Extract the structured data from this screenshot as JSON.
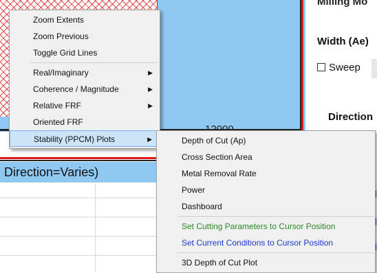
{
  "plot": {
    "axis_value": "12000",
    "direction_label": "Direction=Varies)"
  },
  "right_panel": {
    "cut_text": "Milling Mo",
    "width_label": "Width (Ae)",
    "sweep_label": "Sweep",
    "direction_heading": "Direction"
  },
  "context_menu": {
    "items": [
      {
        "label": "Zoom Extents"
      },
      {
        "label": "Zoom Previous"
      },
      {
        "label": "Toggle Grid Lines"
      },
      {
        "label": "Real/Imaginary",
        "submenu": true
      },
      {
        "label": "Coherence / Magnitude",
        "submenu": true
      },
      {
        "label": "Relative FRF",
        "submenu": true
      },
      {
        "label": "Oriented FRF"
      },
      {
        "label": "Stability (PPCM) Plots",
        "submenu": true,
        "highlighted": true
      }
    ],
    "arrow_glyph": "▶"
  },
  "submenu": {
    "items": [
      {
        "label": "Depth of Cut (Ap)"
      },
      {
        "label": "Cross Section Area"
      },
      {
        "label": "Metal Removal Rate"
      },
      {
        "label": "Power"
      },
      {
        "label": "Dashboard"
      },
      {
        "label": "Set Cutting Parameters to Cursor Position",
        "color": "#2a8a2a"
      },
      {
        "label": "Set Current Conditions to Cursor Position",
        "color": "#1a3ad0"
      },
      {
        "label": "3D Depth of Cut Plot"
      }
    ]
  }
}
